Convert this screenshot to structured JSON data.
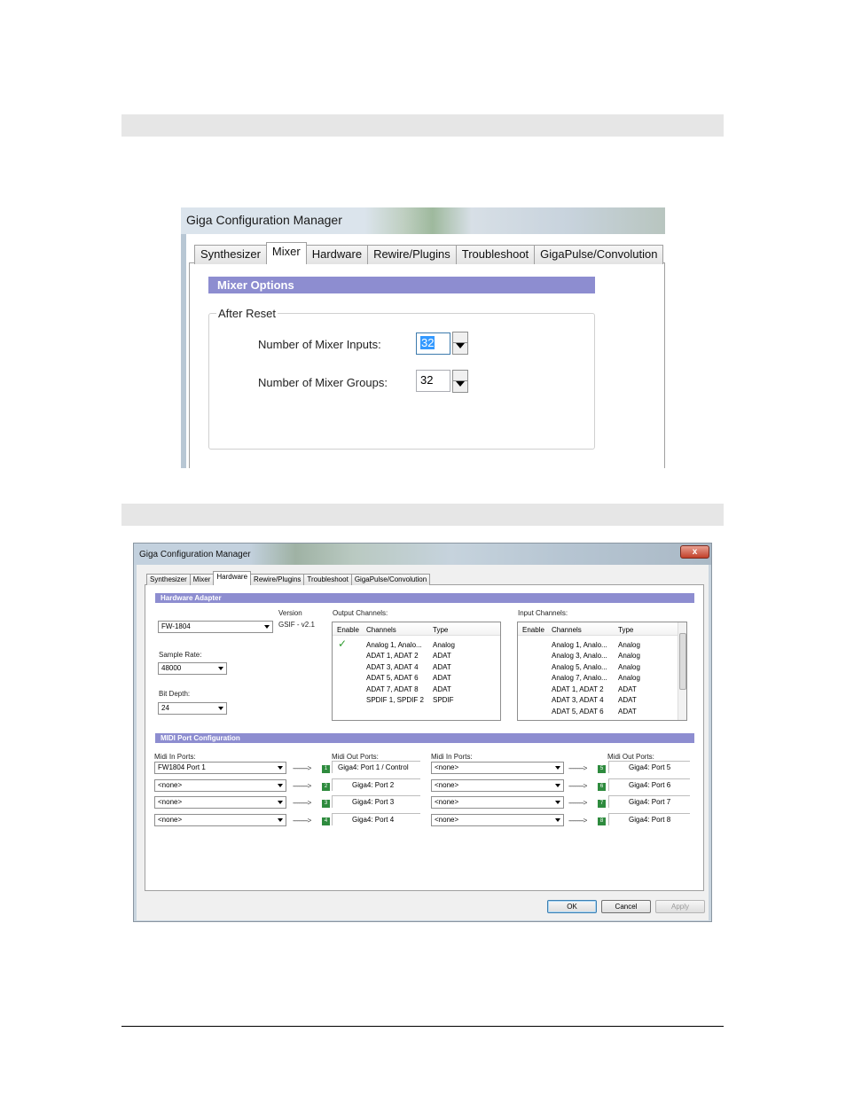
{
  "shot1": {
    "title": "Giga Configuration Manager",
    "tabs": [
      "Synthesizer",
      "Mixer",
      "Hardware",
      "Rewire/Plugins",
      "Troubleshoot",
      "GigaPulse/Convolution"
    ],
    "active_tab": "Mixer",
    "section": "Mixer Options",
    "group_label": "After Reset",
    "inputs_label": "Number of Mixer Inputs:",
    "inputs_value": "32",
    "groups_label": "Number of Mixer Groups:",
    "groups_value": "32"
  },
  "shot2": {
    "title": "Giga Configuration Manager",
    "close_glyph": "x",
    "tabs": [
      "Synthesizer",
      "Mixer",
      "Hardware",
      "Rewire/Plugins",
      "Troubleshoot",
      "GigaPulse/Convolution"
    ],
    "active_tab": "Hardware",
    "hardware_section": "Hardware Adapter",
    "adapter_value": "FW-1804",
    "version_label": "Version",
    "version_value": "GSIF - v2.1",
    "sample_rate_label": "Sample Rate:",
    "sample_rate_value": "48000",
    "bit_depth_label": "Bit Depth:",
    "bit_depth_value": "24",
    "output_label": "Output Channels:",
    "input_label": "Input Channels:",
    "col_enable": "Enable",
    "col_channels": "Channels",
    "col_type": "Type",
    "output_channels": [
      {
        "channels": "Analog 1, Analo...",
        "type": "Analog",
        "enabled": true
      },
      {
        "channels": "ADAT 1, ADAT 2",
        "type": "ADAT",
        "enabled": false
      },
      {
        "channels": "ADAT 3, ADAT 4",
        "type": "ADAT",
        "enabled": false
      },
      {
        "channels": "ADAT 5, ADAT 6",
        "type": "ADAT",
        "enabled": false
      },
      {
        "channels": "ADAT 7, ADAT 8",
        "type": "ADAT",
        "enabled": false
      },
      {
        "channels": "SPDIF 1, SPDIF 2",
        "type": "SPDIF",
        "enabled": false
      }
    ],
    "input_channels": [
      {
        "channels": "Analog 1, Analo...",
        "type": "Analog"
      },
      {
        "channels": "Analog 3, Analo...",
        "type": "Analog"
      },
      {
        "channels": "Analog 5, Analo...",
        "type": "Analog"
      },
      {
        "channels": "Analog 7, Analo...",
        "type": "Analog"
      },
      {
        "channels": "ADAT 1, ADAT 2",
        "type": "ADAT"
      },
      {
        "channels": "ADAT 3, ADAT 4",
        "type": "ADAT"
      },
      {
        "channels": "ADAT 5, ADAT 6",
        "type": "ADAT"
      }
    ],
    "midi_section": "MIDI Port Configuration",
    "midi_in_label": "Midi In Ports:",
    "midi_out_label": "Midi Out Ports:",
    "arrow_text": "---------->",
    "left_ports": [
      {
        "in": "FW1804 Port 1",
        "num": "1",
        "out": "Giga4: Port 1 / Control"
      },
      {
        "in": "<none>",
        "num": "2",
        "out": "Giga4: Port 2"
      },
      {
        "in": "<none>",
        "num": "3",
        "out": "Giga4: Port 3"
      },
      {
        "in": "<none>",
        "num": "4",
        "out": "Giga4: Port 4"
      }
    ],
    "right_ports": [
      {
        "in": "<none>",
        "num": "5",
        "out": "Giga4: Port 5"
      },
      {
        "in": "<none>",
        "num": "6",
        "out": "Giga4: Port 6"
      },
      {
        "in": "<none>",
        "num": "7",
        "out": "Giga4: Port 7"
      },
      {
        "in": "<none>",
        "num": "8",
        "out": "Giga4: Port 8"
      }
    ],
    "ok": "OK",
    "cancel": "Cancel",
    "apply": "Apply"
  }
}
